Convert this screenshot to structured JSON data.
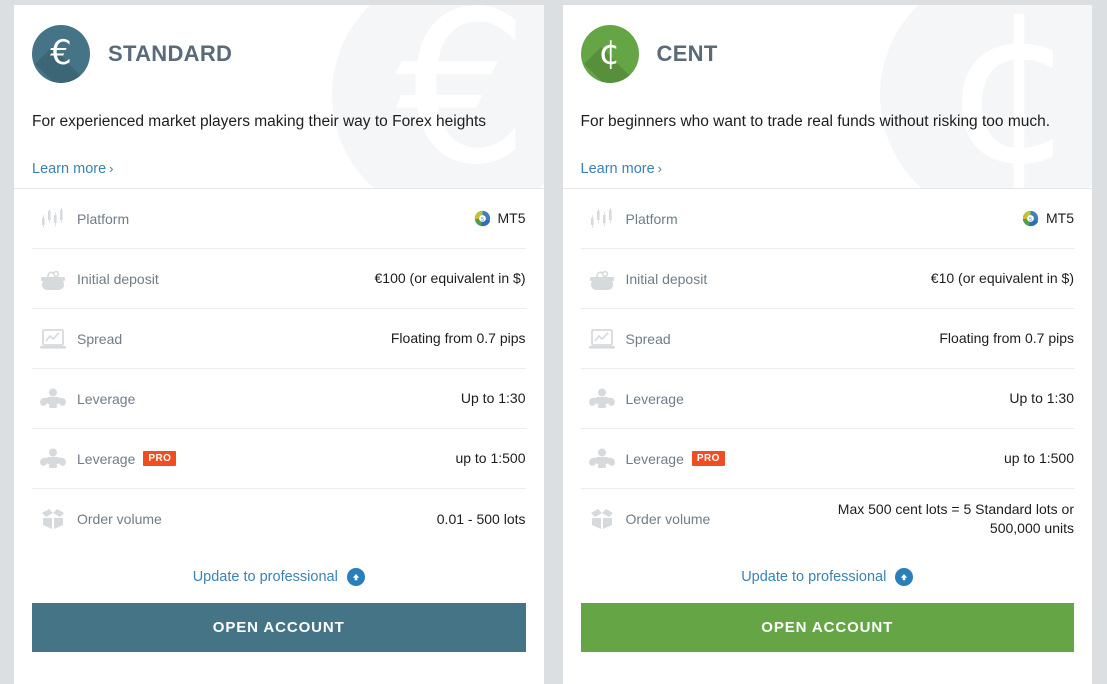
{
  "theme": {
    "page_bg": "#dcdfe1",
    "card_bg": "#ffffff",
    "link_color": "#3a82b5",
    "label_color": "#6f7d89",
    "pro_badge_color": "#f04e22"
  },
  "cards": [
    {
      "id": "standard",
      "title": "STANDARD",
      "accent": "#457487",
      "icon_glyph": "€",
      "icon_name": "euro-badge-icon",
      "watermark_glyph": "€",
      "description": "For experienced market players making their way to Forex heights",
      "learn_more": "Learn more",
      "chevron": "›",
      "rows": [
        {
          "icon": "candlestick-chart-icon",
          "label": "Platform",
          "value": "MT5",
          "has_mt_logo": true
        },
        {
          "icon": "wallet-icon",
          "label": "Initial deposit",
          "value": "€100 (or equivalent in $)",
          "has_mt_logo": false
        },
        {
          "icon": "laptop-chart-icon",
          "label": "Spread",
          "value": "Floating from 0.7 pips",
          "has_mt_logo": false
        },
        {
          "icon": "strongman-icon",
          "label": "Leverage",
          "value": "Up to 1:30",
          "has_mt_logo": false
        },
        {
          "icon": "strongman-icon",
          "label": "Leverage",
          "value": "up to 1:500",
          "has_mt_logo": false,
          "badge": "PRO"
        },
        {
          "icon": "open-box-icon",
          "label": "Order volume",
          "value": "0.01 - 500 lots",
          "has_mt_logo": false
        }
      ],
      "update_label": "Update to professional",
      "open_button": "OPEN ACCOUNT"
    },
    {
      "id": "cent",
      "title": "CENT",
      "accent": "#65a546",
      "icon_glyph": "¢",
      "icon_name": "cent-badge-icon",
      "watermark_glyph": "¢",
      "description": "For beginners who want to trade real funds without risking too much.",
      "learn_more": "Learn more",
      "chevron": "›",
      "rows": [
        {
          "icon": "candlestick-chart-icon",
          "label": "Platform",
          "value": "MT5",
          "has_mt_logo": true
        },
        {
          "icon": "wallet-icon",
          "label": "Initial deposit",
          "value": "€10 (or equivalent in $)",
          "has_mt_logo": false
        },
        {
          "icon": "laptop-chart-icon",
          "label": "Spread",
          "value": "Floating from 0.7 pips",
          "has_mt_logo": false
        },
        {
          "icon": "strongman-icon",
          "label": "Leverage",
          "value": "Up to 1:30",
          "has_mt_logo": false
        },
        {
          "icon": "strongman-icon",
          "label": "Leverage",
          "value": "up to 1:500",
          "has_mt_logo": false,
          "badge": "PRO"
        },
        {
          "icon": "open-box-icon",
          "label": "Order volume",
          "value": "Max 500 cent lots = 5 Standard lots or 500,000 units",
          "has_mt_logo": false
        }
      ],
      "update_label": "Update to professional",
      "open_button": "OPEN ACCOUNT"
    }
  ]
}
